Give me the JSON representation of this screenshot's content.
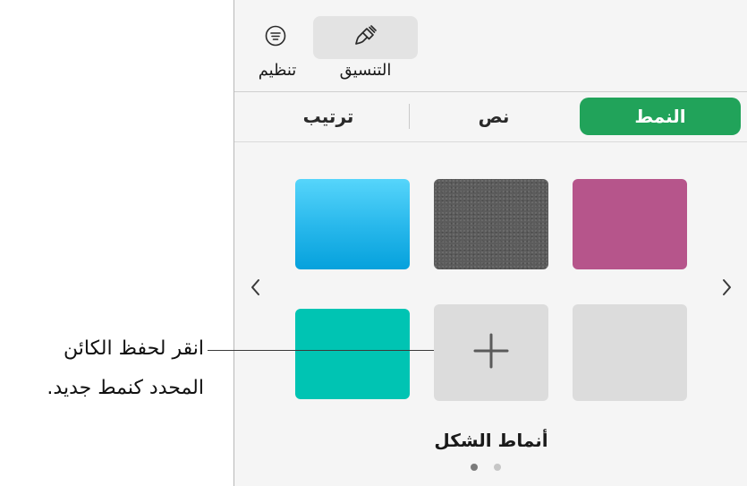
{
  "toolbar": {
    "format_label": "التنسيق",
    "arrange_label": "تنظيم",
    "format_icon": "paintbrush-icon",
    "arrange_icon": "filter-lines-icon"
  },
  "tabs": {
    "style": "النمط",
    "text": "نص",
    "arrange": "ترتيب",
    "active": "style",
    "active_color": "#21a35a"
  },
  "shape_styles": {
    "title": "أنماط الشكل",
    "swatches": [
      {
        "name": "blue-gradient",
        "color": "#2ab9ec"
      },
      {
        "name": "gray-textured",
        "color": "#5c5c5c"
      },
      {
        "name": "pink",
        "color": "#b6558b"
      },
      {
        "name": "teal",
        "color": "#00c4b3"
      },
      {
        "name": "add-style",
        "color": "#dcdcdc"
      },
      {
        "name": "empty",
        "color": "#dcdcdc"
      }
    ],
    "page_count": 2,
    "current_page": 1
  },
  "callout": {
    "line1": "انقر لحفظ الكائن",
    "line2": "المحدد كنمط جديد."
  }
}
